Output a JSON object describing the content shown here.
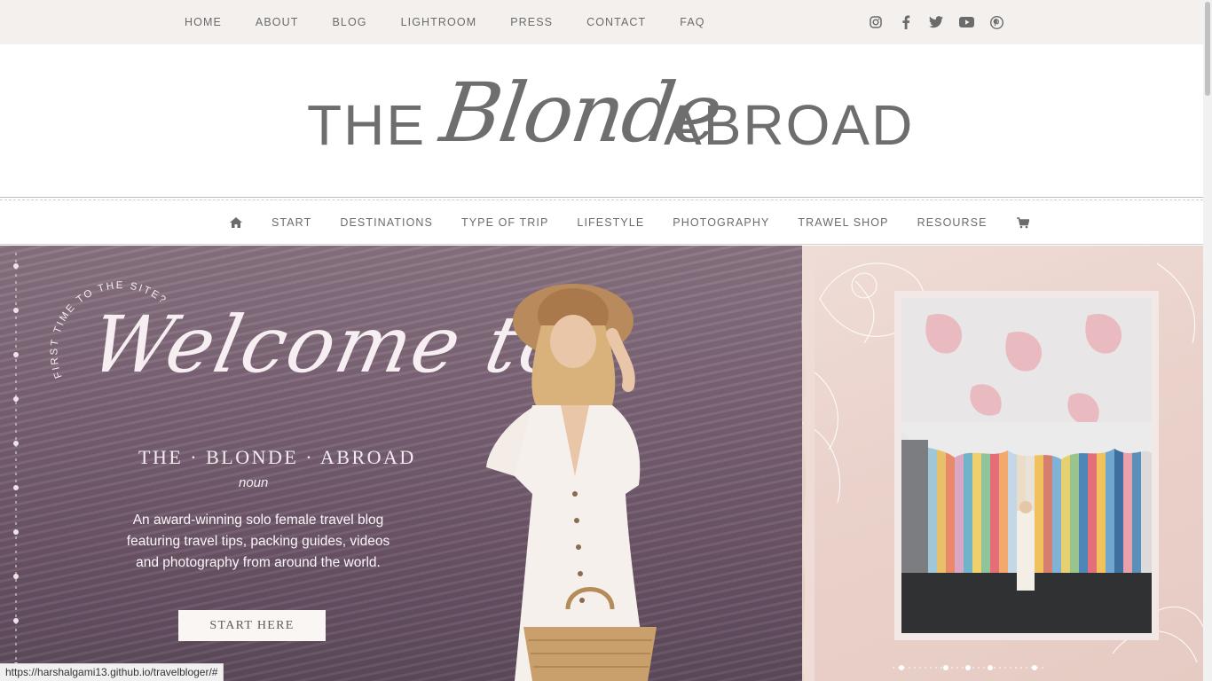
{
  "top_nav": {
    "items": [
      "HOME",
      "ABOUT",
      "BLOG",
      "LIGHTROOM",
      "PRESS",
      "CONTACT",
      "FAQ"
    ],
    "social_icons": [
      "instagram-icon",
      "facebook-icon",
      "twitter-icon",
      "youtube-icon",
      "pinterest-icon"
    ]
  },
  "logo": {
    "the": "THE",
    "script": "Blonde",
    "abroad": "ABROAD"
  },
  "main_nav": {
    "home_icon": "home-icon",
    "items": [
      "START",
      "DESTINATIONS",
      "TYPE OF TRIP",
      "LIFESTYLE",
      "PHOTOGRAPHY",
      "TRAWEL SHOP",
      "RESOURSE"
    ],
    "cart_icon": "cart-icon"
  },
  "hero": {
    "arc_text": "FIRST TIME TO THE SITE?",
    "welcome": "Welcome to",
    "brand": "THE · BLONDE · ABROAD",
    "noun": "noun",
    "description": "An award-winning solo female travel blog featuring travel tips, packing guides, videos and photography from around the world.",
    "button": "START HERE"
  },
  "status_url": "https://harshalgami13.github.io/travelbloger/#",
  "colors": {
    "topbar_bg": "#f4f0ed",
    "nav_text": "#6b6b6b",
    "hero_lavender": "#7b6476",
    "hero_pink": "#ead3cc"
  }
}
